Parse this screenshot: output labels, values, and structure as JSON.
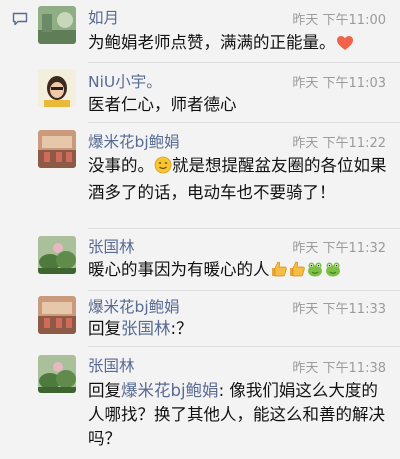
{
  "comments": [
    {
      "name": "如月",
      "time": "昨天 下午11:00",
      "text_before": "为鲍娟老师点赞，满满的正能量。",
      "trailing_icon": "heart-icon"
    },
    {
      "name": "NiU小宇。",
      "time": "昨天 下午11:03",
      "text": "医者仁心，师者德心"
    },
    {
      "name": "爆米花bj鲍娟",
      "time": "昨天 下午11:22",
      "text_before": "没事的。",
      "smile_icon": "smile-emoji",
      "text_after": "就是想提醒盆友圈的各位如果酒多了的话，电动车也不要骑了！"
    },
    {
      "name": "张国林",
      "time": "昨天 下午11:32",
      "text": "暖心的事因为有暖心的人",
      "trailing_icons": [
        "thumbs-up-emoji",
        "thumbs-up-emoji",
        "frog-emoji",
        "frog-emoji"
      ]
    },
    {
      "name": "爆米花bj鲍娟",
      "time": "昨天 下午11:33",
      "reply_prefix": "回复",
      "reply_to": "张国林",
      "reply_text": ":？"
    },
    {
      "name": "张国林",
      "time": "昨天 下午11:38",
      "reply_prefix": "回复",
      "reply_to": "爆米花bj鲍娟",
      "reply_text": ": 像我们娟这么大度的人哪找？换了其他人，能这么和善的解决吗？"
    }
  ],
  "colors": {
    "background": "#f3f3f3",
    "name": "#586b94",
    "time": "#9b9b9b",
    "text": "#111111",
    "heart": "#f0634a"
  }
}
